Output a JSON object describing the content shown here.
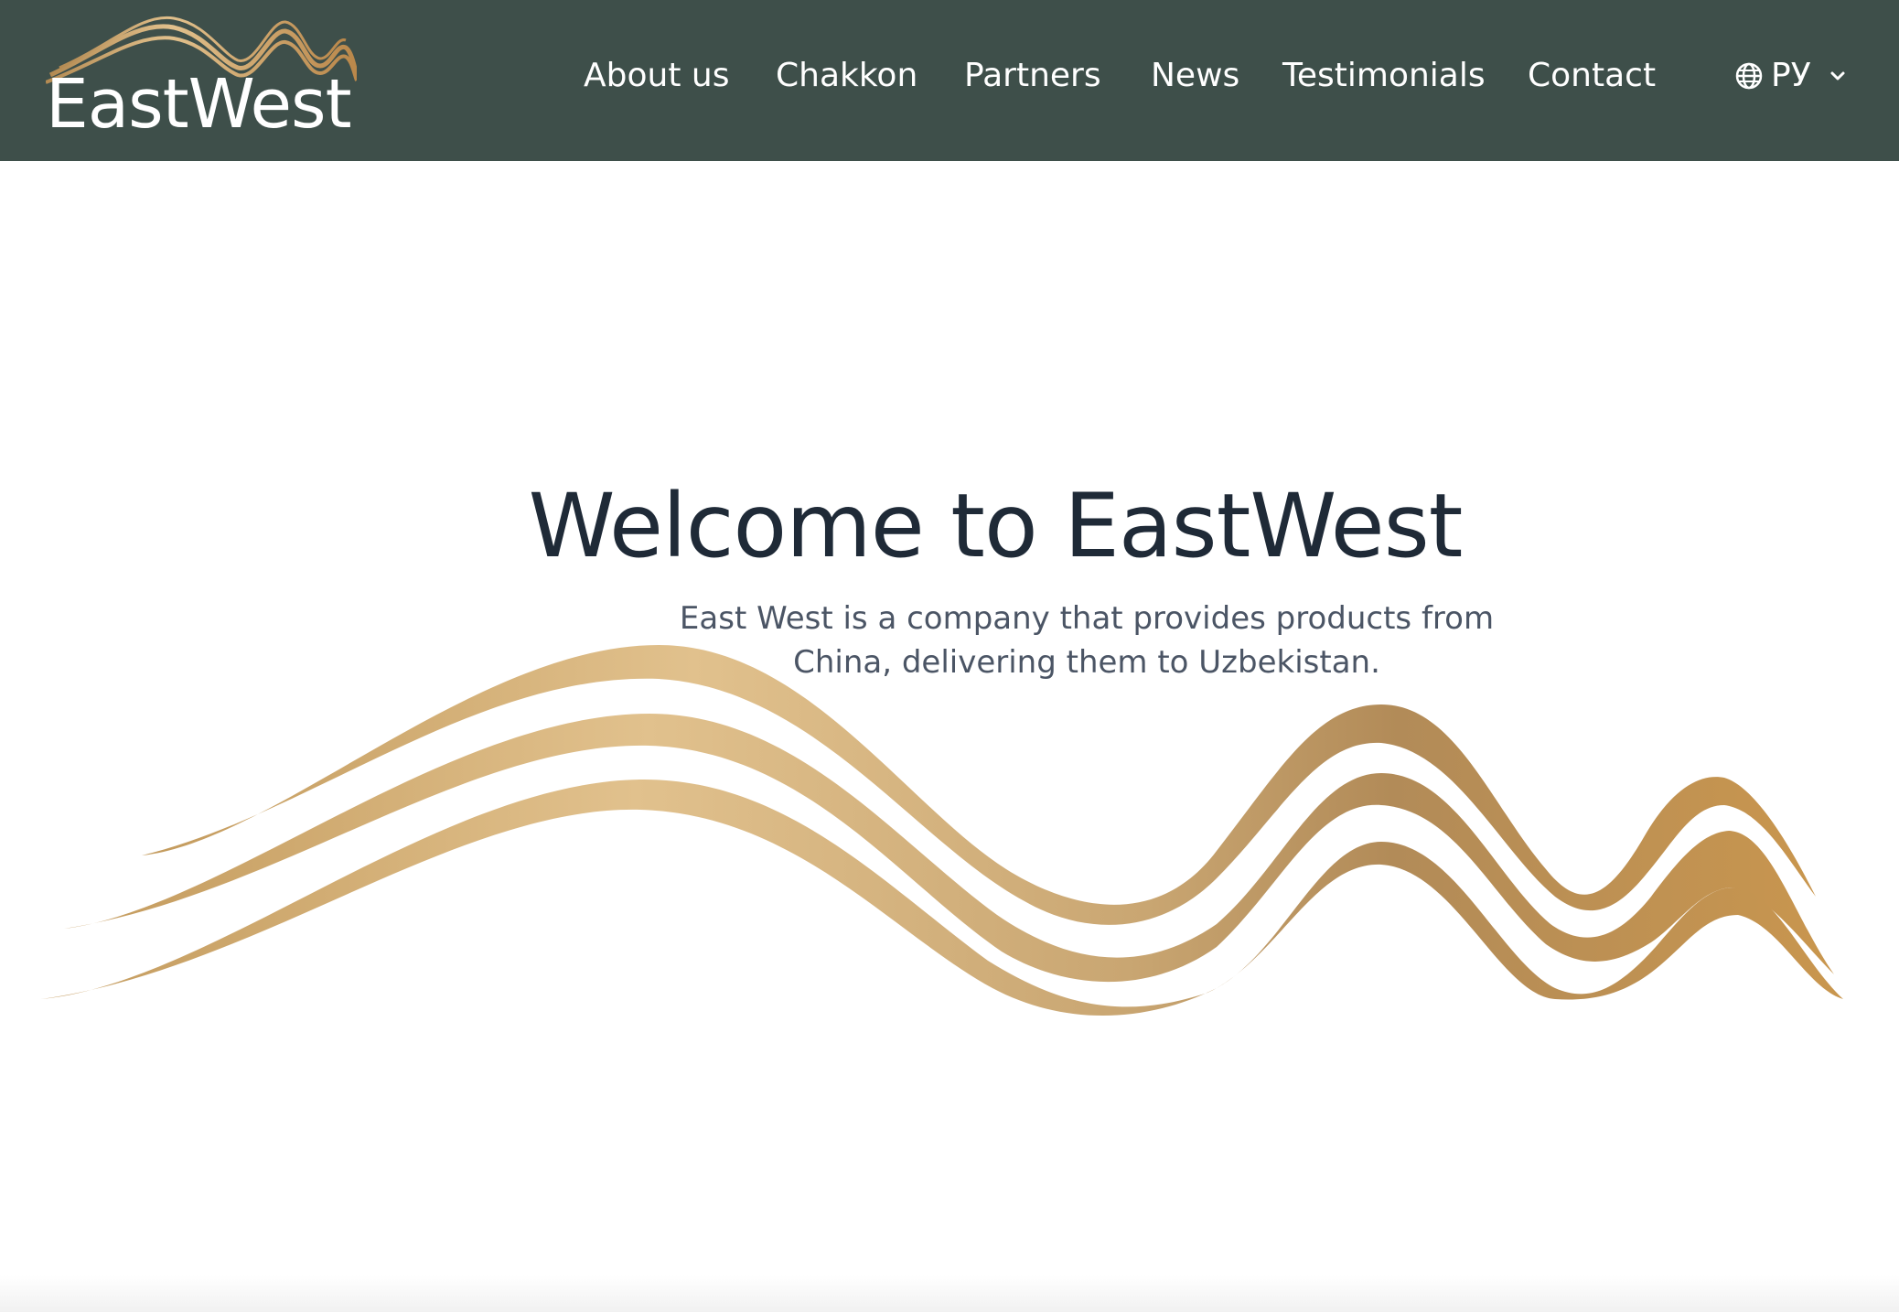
{
  "brand": {
    "name": "EastWest",
    "accent_gold": "#c8a36a",
    "header_bg": "#3e4f4a"
  },
  "nav": {
    "items": [
      {
        "label": "About us"
      },
      {
        "label": "Chakkon"
      },
      {
        "label": "Partners"
      },
      {
        "label": "News"
      },
      {
        "label": "Testimonials"
      },
      {
        "label": "Contact"
      }
    ]
  },
  "language": {
    "icon": "globe-icon",
    "selected": "РУ",
    "dropdown_icon": "chevron-down-icon"
  },
  "hero": {
    "title": "Welcome to EastWest",
    "subtitle_line1": "East West is a company that provides products from",
    "subtitle_line2": "China, delivering them to Uzbekistan."
  }
}
